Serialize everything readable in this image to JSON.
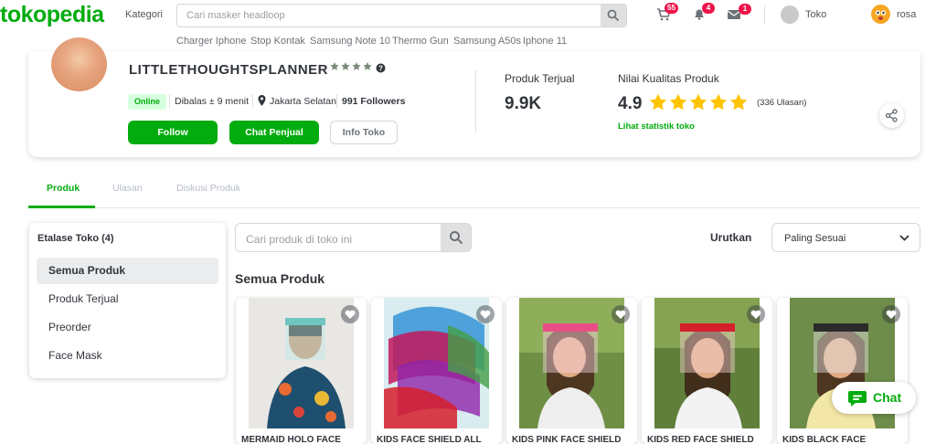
{
  "header": {
    "logo": "tokopedia",
    "kategori_label": "Kategori",
    "search_placeholder": "Cari masker headloop",
    "suggestions": [
      "Charger Iphone",
      "Stop Kontak",
      "Samsung Note 10",
      "Thermo Gun",
      "Samsung A50s",
      "Iphone 11"
    ],
    "cart_count": "55",
    "notif_count": "4",
    "msg_count": "1",
    "toko_label": "Toko",
    "user_name": "rosa",
    "icons": [
      "search-icon",
      "cart-icon",
      "bell-icon",
      "mail-icon"
    ]
  },
  "shop": {
    "name": "LITTLETHOUGHTSPLANNER",
    "status": "Online",
    "reply_time": "Dibalas ± 9 menit",
    "location": "Jakarta Selatan",
    "followers": "991 Followers",
    "follow_label": "Follow",
    "chat_label": "Chat Penjual",
    "info_label": "Info Toko",
    "sold_label": "Produk Terjual",
    "sold_value": "9.9K",
    "quality_label": "Nilai Kualitas Produk",
    "rating": "4.9",
    "rating_stars": 5,
    "reviews": "(336 Ulasan)",
    "stats_link": "Lihat statistik toko"
  },
  "tabs": [
    {
      "label": "Produk",
      "active": true
    },
    {
      "label": "Ulasan",
      "active": false
    },
    {
      "label": "Diskusi Produk",
      "active": false
    }
  ],
  "etalase": {
    "title": "Etalase Toko (4)",
    "items": [
      "Semua Produk",
      "Produk Terjual",
      "Preorder",
      "Face Mask"
    ],
    "selected": 0
  },
  "product_search_placeholder": "Cari produk di toko ini",
  "sort": {
    "label": "Urutkan",
    "value": "Paling Sesuai"
  },
  "section_title": "Semua Produk",
  "products": [
    {
      "title": "MERMAID HOLO FACE",
      "accent": "#6fc6c1"
    },
    {
      "title": "KIDS FACE SHIELD ALL",
      "accent": "#c2185b"
    },
    {
      "title": "KIDS PINK FACE SHIELD",
      "accent": "#e94f86"
    },
    {
      "title": "KIDS RED FACE SHIELD",
      "accent": "#d61f2c"
    },
    {
      "title": "KIDS BLACK FACE",
      "accent": "#2b2b2b"
    }
  ],
  "chat_float_label": "Chat",
  "colors": {
    "brand": "#03ac0e",
    "badge": "#ef144a",
    "star": "#ffc400"
  }
}
